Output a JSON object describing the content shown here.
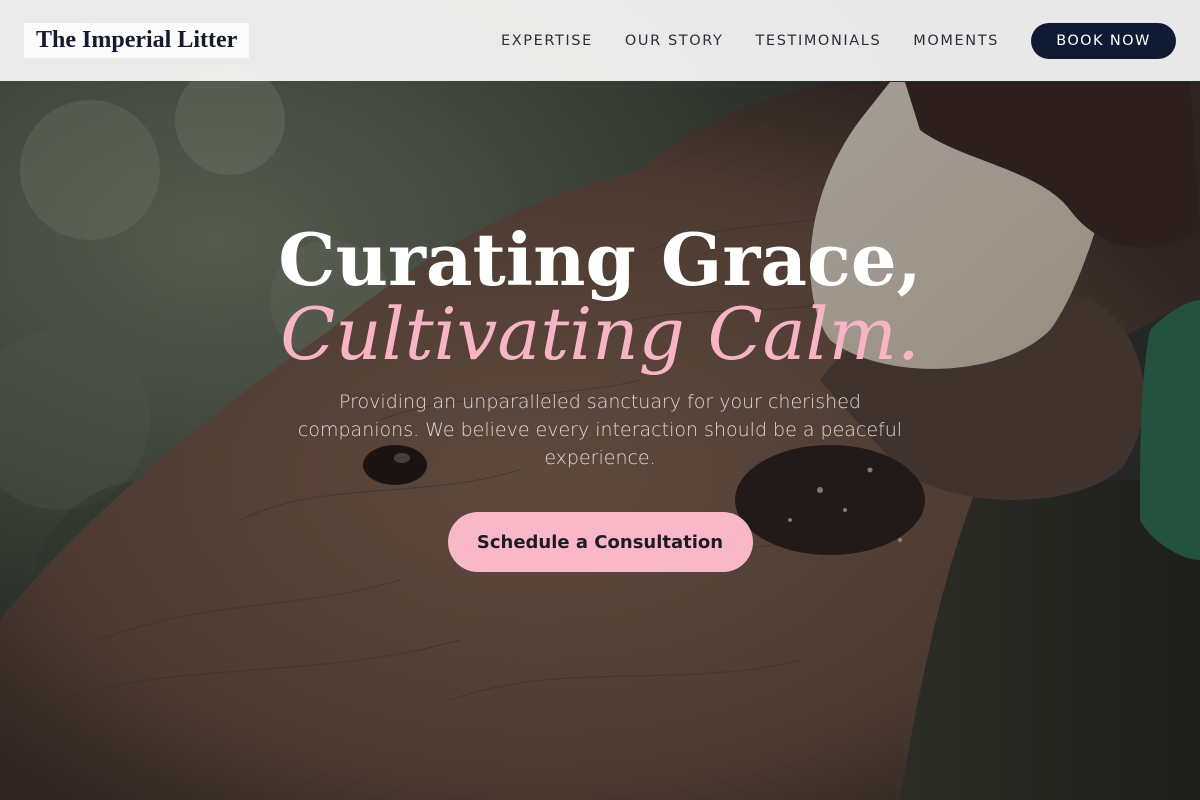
{
  "header": {
    "brand": "The Imperial Litter",
    "nav": [
      {
        "label": "EXPERTISE"
      },
      {
        "label": "OUR STORY"
      },
      {
        "label": "TESTIMONIALS"
      },
      {
        "label": "MOMENTS"
      }
    ],
    "cta_label": "BOOK NOW"
  },
  "hero": {
    "headline_line1": "Curating Grace,",
    "headline_line2": "Cultivating Calm.",
    "subtext": "Providing an unparalleled sanctuary for your cherished companions. We believe every interaction should be a peaceful experience.",
    "cta_label": "Schedule a Consultation",
    "background_image": "elephant-calf-bottle-feeding-photo"
  },
  "colors": {
    "header_bg": "#f7f7f7",
    "brand_text": "#151a2e",
    "nav_text": "#2c2f3a",
    "book_button_bg": "#111a33",
    "accent_pink": "#f7b4c5",
    "cta_bg": "#f9b8c8"
  }
}
